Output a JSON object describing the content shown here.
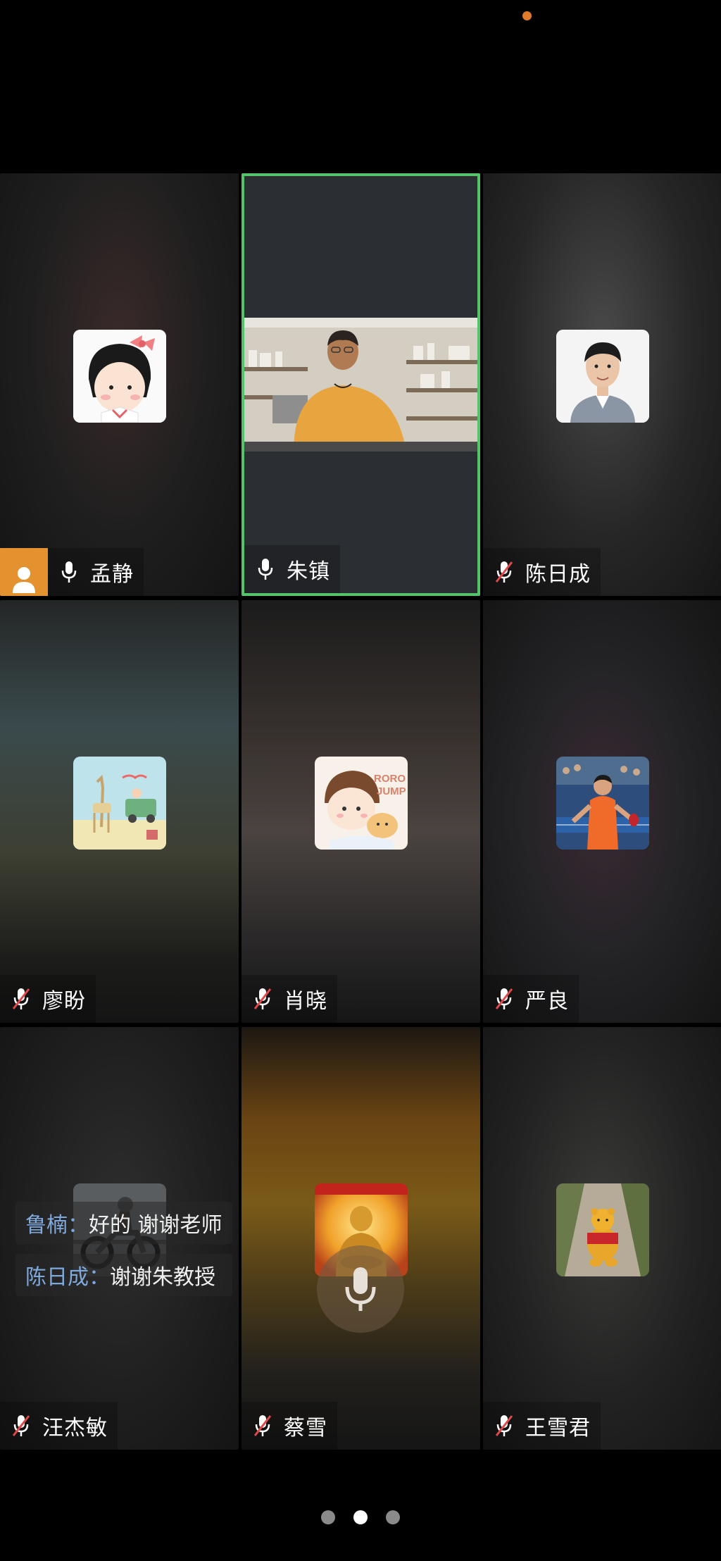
{
  "status": {
    "recording_indicator_color": "#e07b2c"
  },
  "participants": [
    {
      "name": "孟静",
      "mic": "on",
      "host": true,
      "active_speaker": false,
      "avatar": "cartoon-girl-avatar"
    },
    {
      "name": "朱镇",
      "mic": "on",
      "host": false,
      "active_speaker": true,
      "avatar": "video-feed"
    },
    {
      "name": "陈日成",
      "mic": "muted",
      "host": false,
      "active_speaker": false,
      "avatar": "portrait-photo"
    },
    {
      "name": "廖盼",
      "mic": "muted",
      "host": false,
      "active_speaker": false,
      "avatar": "beach-illustration"
    },
    {
      "name": "肖晓",
      "mic": "muted",
      "host": false,
      "active_speaker": false,
      "avatar": "roro-jump-sticker"
    },
    {
      "name": "严良",
      "mic": "muted",
      "host": false,
      "active_speaker": false,
      "avatar": "table-tennis-photo"
    },
    {
      "name": "汪杰敏",
      "mic": "muted",
      "host": false,
      "active_speaker": false,
      "avatar": "motorbike-photo"
    },
    {
      "name": "蔡雪",
      "mic": "muted",
      "host": false,
      "active_speaker": false,
      "avatar": "golden-buddha-photo"
    },
    {
      "name": "王雪君",
      "mic": "muted",
      "host": false,
      "active_speaker": false,
      "avatar": "winnie-the-pooh-toy"
    }
  ],
  "chat": [
    {
      "sender": "鲁楠",
      "separator": "：",
      "message": "好的 谢谢老师"
    },
    {
      "sender": "陈日成",
      "separator": "：",
      "message": "谢谢朱教授"
    }
  ],
  "pager": {
    "pages": 3,
    "current": 2
  },
  "colors": {
    "active_speaker": "#54c36a",
    "host_badge": "#e3922f",
    "chat_sender": "#7fa9dd"
  }
}
